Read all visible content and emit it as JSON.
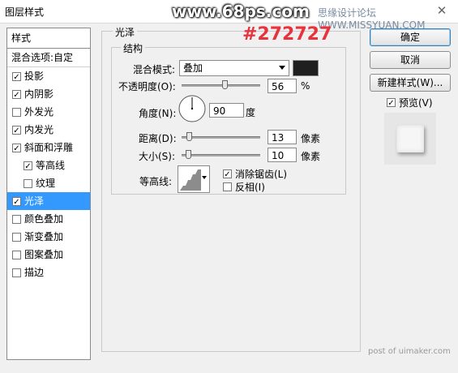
{
  "window": {
    "title": "图层样式",
    "close_glyph": "✕"
  },
  "watermarks": {
    "site": "www.68ps.com",
    "forum": "思缘设计论坛 WWW.MISSYUAN.COM",
    "footer": "post of uimaker.com"
  },
  "annotation": "#272727",
  "styles_panel": {
    "header": "样式",
    "blend_options": "混合选项:自定",
    "items": [
      {
        "label": "投影",
        "checked": true
      },
      {
        "label": "内阴影",
        "checked": true
      },
      {
        "label": "外发光",
        "checked": false
      },
      {
        "label": "内发光",
        "checked": true
      },
      {
        "label": "斜面和浮雕",
        "checked": true
      },
      {
        "label": "等高线",
        "checked": true,
        "sub": true
      },
      {
        "label": "纹理",
        "checked": false,
        "sub": true
      },
      {
        "label": "光泽",
        "checked": true,
        "selected": true
      },
      {
        "label": "颜色叠加",
        "checked": false
      },
      {
        "label": "渐变叠加",
        "checked": false
      },
      {
        "label": "图案叠加",
        "checked": false
      },
      {
        "label": "描边",
        "checked": false
      }
    ]
  },
  "satin": {
    "group_title": "光泽",
    "structure_title": "结构",
    "blend_mode_label": "混合模式:",
    "blend_mode_value": "叠加",
    "blend_color": "#1f1f1f",
    "opacity_label": "不透明度(O):",
    "opacity_value": "56",
    "opacity_unit": "%",
    "angle_label": "角度(N):",
    "angle_value": "90",
    "angle_unit": "度",
    "distance_label": "距离(D):",
    "distance_value": "13",
    "distance_unit": "像素",
    "size_label": "大小(S):",
    "size_value": "10",
    "size_unit": "像素",
    "contour_label": "等高线:",
    "antialias_label": "消除锯齿(L)",
    "antialias_checked": true,
    "invert_label": "反相(I)",
    "invert_checked": false
  },
  "buttons": {
    "ok": "确定",
    "cancel": "取消",
    "new_style": "新建样式(W)...",
    "preview_label": "预览(V)",
    "preview_checked": true
  },
  "check_glyph": "✓"
}
